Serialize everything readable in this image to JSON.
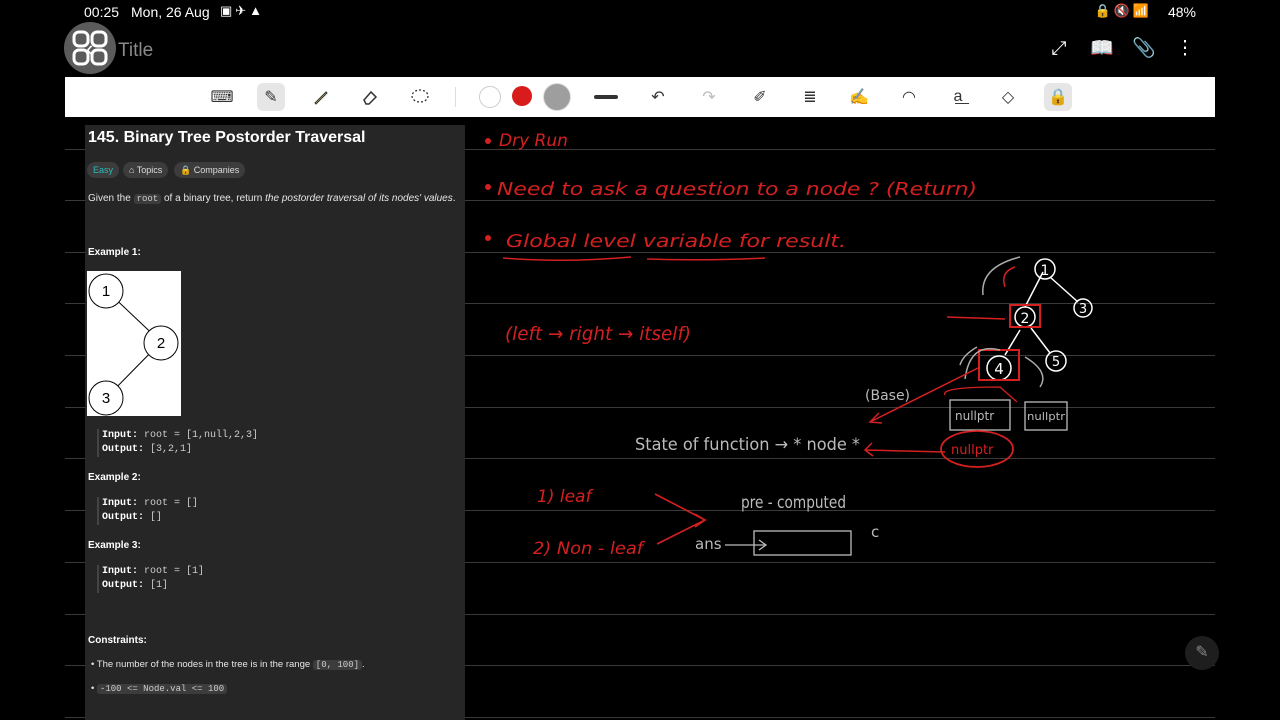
{
  "status": {
    "time": "00:25",
    "date": "Mon, 26 Aug",
    "battery": "48%"
  },
  "header": {
    "title": "Title"
  },
  "toolbar": {
    "tools": [
      "keyboard-icon",
      "pen-icon",
      "highlighter-icon",
      "eraser-icon",
      "lasso-icon"
    ],
    "colors": [
      "#ffffff",
      "#d81b1b",
      "#9e9e9e"
    ]
  },
  "problem": {
    "title": "145. Binary Tree Postorder Traversal",
    "difficulty": "Easy",
    "topics": "Topics",
    "companies": "Companies",
    "desc_before": "Given the ",
    "desc_code": "root",
    "desc_mid": " of a binary tree, return ",
    "desc_em": "the postorder traversal of its nodes' values",
    "desc_end": ".",
    "ex1_heading": "Example 1:",
    "ex1_input_label": "Input:",
    "ex1_input": "root = [1,null,2,3]",
    "ex1_output_label": "Output:",
    "ex1_output": "[3,2,1]",
    "ex2_heading": "Example 2:",
    "ex2_input_label": "Input:",
    "ex2_input": "root = []",
    "ex2_output_label": "Output:",
    "ex2_output": "[]",
    "ex3_heading": "Example 3:",
    "ex3_input_label": "Input:",
    "ex3_input": "root = [1]",
    "ex3_output_label": "Output:",
    "ex3_output": "[1]",
    "constraints_heading": "Constraints:",
    "constraint1_text": "The number of the nodes in the tree is in the range ",
    "constraint1_code": "[0, 100]",
    "constraint1_end": ".",
    "constraint2_code": "-100 <= Node.val <= 100",
    "tree_nodes": [
      "1",
      "2",
      "3"
    ]
  },
  "notes": {
    "line1": "Dry Run",
    "line2": "Need to ask a question to a node ? (Return)",
    "line3": "Global level variable for result.",
    "order": "(left → right → itself)",
    "base": "(Base)",
    "state": "State of function → * node *",
    "leaf1": "1) leaf",
    "leaf2": "2) Non - leaf",
    "precomputed": "pre - computed",
    "ans": "ans",
    "nullptr1": "nullptr",
    "nullptr2": "nullptr",
    "nullptr3": "nullptr",
    "c_mark": "c",
    "tree_nodes": [
      "1",
      "2",
      "3",
      "4",
      "5"
    ]
  }
}
